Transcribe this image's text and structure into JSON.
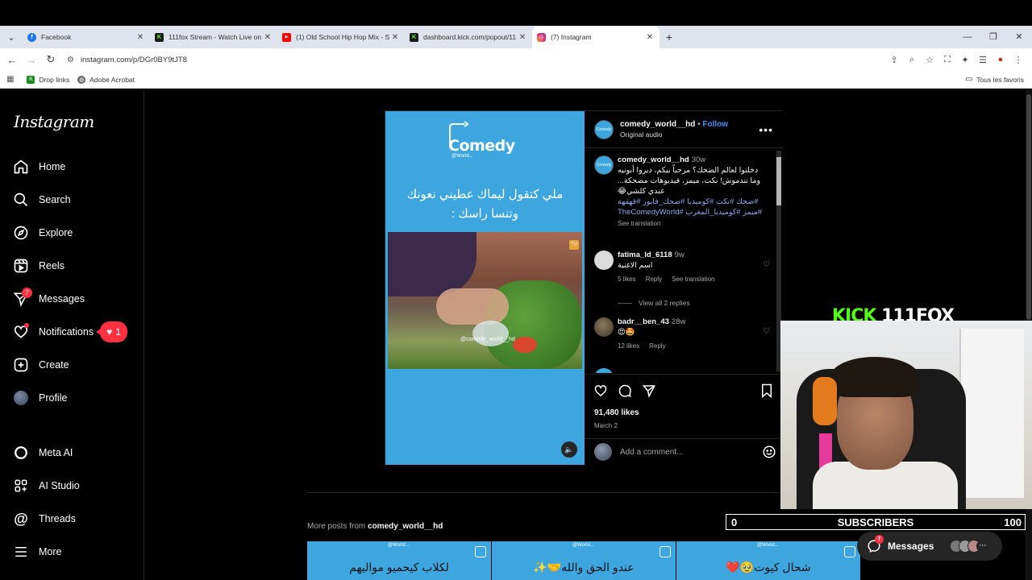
{
  "browser": {
    "tabs": [
      {
        "label": "Facebook",
        "favicon_color": "#1877f2",
        "glyph": "f"
      },
      {
        "label": "111fox Stream - Watch Live on",
        "favicon_color": "#1b1b1b",
        "glyph": "K"
      },
      {
        "label": "(1) Old School Hip Hop Mix - S",
        "favicon_color": "#ff0000",
        "glyph": "▶"
      },
      {
        "label": "dashboard.kick.com/popout/11",
        "favicon_color": "#1b1b1b",
        "glyph": "K"
      },
      {
        "label": "(7) Instagram",
        "favicon_color": "#e1306c",
        "glyph": "◎"
      }
    ],
    "url": "instagram.com/p/DGr0BY9tJT8",
    "bookmarks": [
      {
        "label": "Drop links"
      },
      {
        "label": "Adobe Acrobat"
      }
    ],
    "all_bookmarks": "Tous les favoris"
  },
  "instagram": {
    "logo": "Instagram",
    "nav": {
      "home": "Home",
      "search": "Search",
      "explore": "Explore",
      "reels": "Reels",
      "messages": "Messages",
      "messages_badge": "7",
      "notifications": "Notifications",
      "notifications_pill": "1",
      "create": "Create",
      "profile": "Profile",
      "meta_ai": "Meta AI",
      "ai_studio": "AI Studio",
      "threads": "Threads",
      "more": "More"
    },
    "post": {
      "media_logo": "Comedy",
      "media_logo_sub": "@World...",
      "media_caption": "ملي كتقول ليماك عطيني نعونك وتنسا راسك :",
      "video_watermark": "@comedy_world__hd",
      "username": "comedy_world__hd",
      "follow": "Follow",
      "audio": "Original audio",
      "caption": {
        "user": "comedy_world__hd",
        "time": "30w",
        "text": "دخلتوا لعالم الضحك؟ مرحباً بيكم، ديروا أبونيه وما تندموش! نكت، ميمز، فيديوهات مضحكة... عندي كلشي😂",
        "tags": "#ضحك #نكت #كوميديا #ضحك_فابور #قهقهة #ميمز #كوميديا_المغرب #TheComedyWorld",
        "see_translation": "See translation"
      },
      "comments": [
        {
          "user": "fatima_ld_6118",
          "time": "9w",
          "text": "اسم الاغنية",
          "likes": "5 likes",
          "reply": "Reply",
          "translate": "See translation",
          "view_replies": "View all 2 replies"
        },
        {
          "user": "badr__ben_43",
          "time": "28w",
          "text": "😍🤩",
          "likes": "12 likes",
          "reply": "Reply"
        }
      ],
      "likes": "91,480 likes",
      "date": "March 2",
      "add_comment_placeholder": "Add a comment..."
    },
    "more_posts": {
      "prefix": "More posts from",
      "user": "comedy_world__hd",
      "thumbs": [
        {
          "text": "لكلاب كيحميو مواليهم",
          "logo": "@World..."
        },
        {
          "text": "عندو الحق والله🤝✨",
          "logo": "@World..."
        },
        {
          "text": "شحال كيوت🥹❤️",
          "logo": "@World..."
        }
      ]
    },
    "floating_messages": {
      "label": "Messages",
      "badge": "7"
    }
  },
  "stream": {
    "kick_brand": "KICK",
    "channel": "111FOX",
    "sub_current": "0",
    "sub_label": "SUBSCRIBERS",
    "sub_goal": "100"
  }
}
